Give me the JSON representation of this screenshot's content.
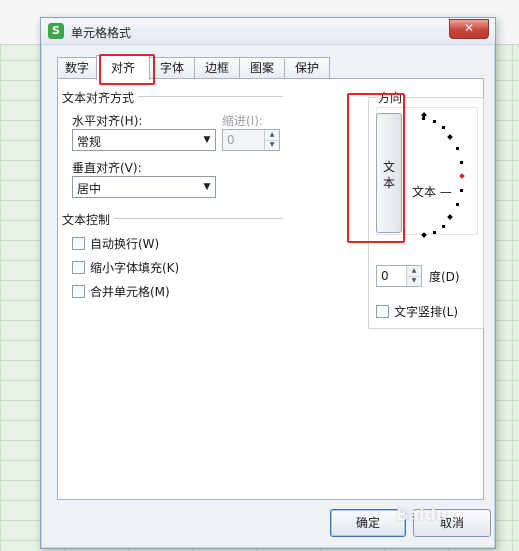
{
  "dialog": {
    "title": "单元格格式",
    "app_icon": "S",
    "close_glyph": "✕"
  },
  "tabs": [
    {
      "label": "数字"
    },
    {
      "label": "对齐"
    },
    {
      "label": "字体"
    },
    {
      "label": "边框"
    },
    {
      "label": "图案"
    },
    {
      "label": "保护"
    }
  ],
  "alignment": {
    "section_title": "文本对齐方式",
    "horizontal_label": "水平对齐(H):",
    "horizontal_value": "常规",
    "indent_label": "缩进(I):",
    "indent_value": "0",
    "vertical_label": "垂直对齐(V):",
    "vertical_value": "居中"
  },
  "text_control": {
    "section_title": "文本控制",
    "wrap_text": "自动换行(W)",
    "shrink_to_fit": "缩小字体填充(K)",
    "merge_cells": "合并单元格(M)"
  },
  "orientation": {
    "title": "方向",
    "vertical_text_char1": "文",
    "vertical_text_char2": "本",
    "dial_text": "文本 —",
    "degree_value": "0",
    "degree_label": "度(D)",
    "vertical_text_checkbox": "文字竖排(L)"
  },
  "buttons": {
    "ok": "确定",
    "cancel": "取消"
  },
  "watermark": "Baidu",
  "colors": {
    "highlight": "#e0262a",
    "dial_dot": "#000000",
    "dial_marker": "#d12a2a"
  }
}
